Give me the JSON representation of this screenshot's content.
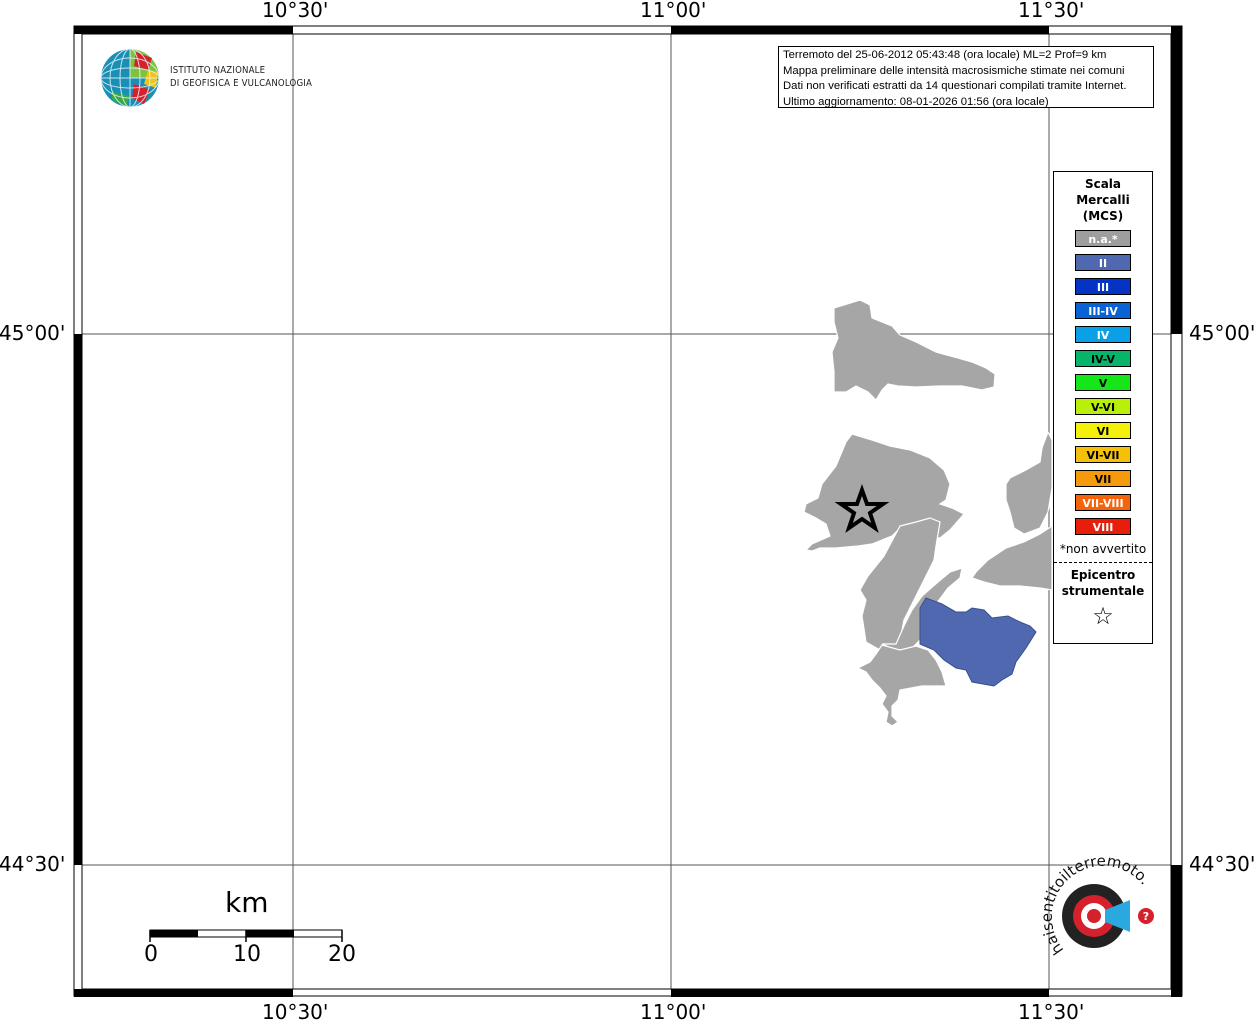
{
  "map": {
    "lon_labels": [
      "10°30'",
      "11°00'",
      "11°30'"
    ],
    "lat_labels": [
      "45°00'",
      "44°30'"
    ]
  },
  "info": {
    "line1": "Terremoto del 25-06-2012 05:43:48 (ora locale) ML=2 Prof=9 km",
    "line2": "Mappa preliminare delle intensità macrosismiche stimate nei comuni",
    "line3": "Dati non verificati estratti da 14 questionari compilati tramite Internet.",
    "line4": "Ultimo aggiornamento: 08-01-2026 01:56 (ora locale)"
  },
  "logo": {
    "name_line1": "ISTITUTO NAZIONALE",
    "name_line2": "DI GEOFISICA E VULCANOLOGIA",
    "haisentito_text": "haisentitoilterremoto.it"
  },
  "legend": {
    "title_line1": "Scala",
    "title_line2": "Mercalli",
    "title_line3": "(MCS)",
    "items": [
      {
        "label": "n.a.*",
        "color": "#9e9e9e"
      },
      {
        "label": "II",
        "color": "#4f68b0"
      },
      {
        "label": "III",
        "color": "#0533c4"
      },
      {
        "label": "III-IV",
        "color": "#0a63d4"
      },
      {
        "label": "IV",
        "color": "#0aa0e8"
      },
      {
        "label": "IV-V",
        "color": "#06b46a"
      },
      {
        "label": "V",
        "color": "#14e61a"
      },
      {
        "label": "V-VI",
        "color": "#b8f00a"
      },
      {
        "label": "VI",
        "color": "#f5f00a"
      },
      {
        "label": "VI-VII",
        "color": "#f5c00a"
      },
      {
        "label": "VII",
        "color": "#f59a0a"
      },
      {
        "label": "VII-VIII",
        "color": "#f5640a"
      },
      {
        "label": "VIII",
        "color": "#e61e0a"
      }
    ],
    "note": "*non avvertito",
    "epicenter_line1": "Epicentro",
    "epicenter_line2": "strumentale",
    "epicenter_symbol": "☆"
  },
  "scalebar": {
    "unit": "km",
    "ticks": [
      "0",
      "10",
      "20"
    ]
  },
  "colors": {
    "not_felt": "#a6a6a6",
    "intensity_II": "#4f68b0"
  }
}
